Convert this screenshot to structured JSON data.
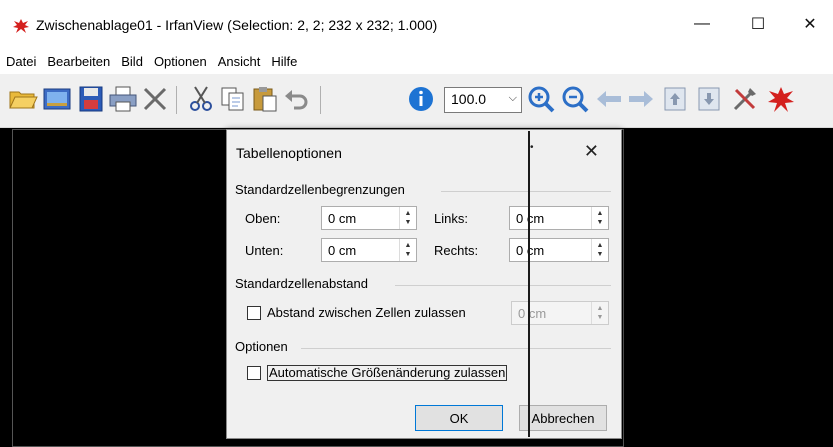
{
  "window": {
    "title": "Zwischenablage01 - IrfanView (Selection: 2, 2; 232 x 232; 1.000)",
    "minimize": "—",
    "maximize": "☐",
    "close": "✕"
  },
  "menu": [
    "Datei",
    "Bearbeiten",
    "Bild",
    "Optionen",
    "Ansicht",
    "Hilfe"
  ],
  "toolbar": {
    "zoom_value": "100.0",
    "icons": [
      "open-folder-icon",
      "slideshow-icon",
      "save-icon",
      "print-icon",
      "delete-icon",
      "cut-icon",
      "copy-icon",
      "paste-icon",
      "undo-icon",
      "info-icon",
      "zoom-in-icon",
      "zoom-out-icon",
      "previous-icon",
      "next-icon",
      "first-page-icon",
      "last-page-icon",
      "settings-icon",
      "irfanview-icon"
    ]
  },
  "dialog": {
    "title": "Tabellenoptionen",
    "close": "✕",
    "group_cell_margins": "Standardzellenbegrenzungen",
    "label_top": "Oben:",
    "value_top": "0 cm",
    "label_left": "Links:",
    "value_left": "0 cm",
    "label_bottom": "Unten:",
    "value_bottom": "0 cm",
    "label_right": "Rechts:",
    "value_right": "0 cm",
    "group_cell_spacing": "Standardzellenabstand",
    "allow_spacing_label": "Abstand zwischen Zellen zulassen",
    "spacing_value": "0 cm",
    "group_options": "Optionen",
    "auto_resize_label": "Automatische Größenänderung zulassen",
    "ok": "OK",
    "cancel": "Abbrechen"
  },
  "colors": {
    "image_background": "#000000",
    "accent": "#0078d7"
  }
}
